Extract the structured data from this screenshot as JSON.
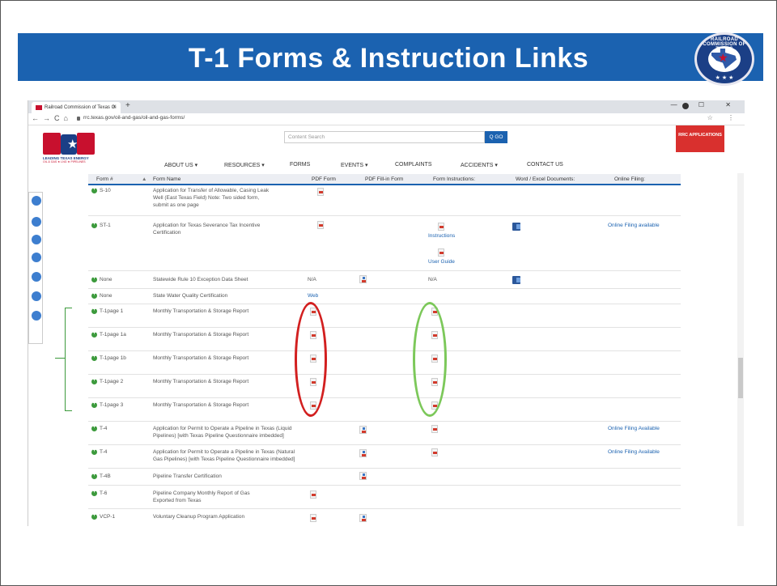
{
  "slide": {
    "title": "T-1 Forms & Instruction Links"
  },
  "seal": {
    "ring_text": "RAILROAD COMMISSION OF TEXAS",
    "bottom": "★ ★ ★"
  },
  "browser": {
    "tab_title": "Railroad Commission of Texas Oi",
    "tab_close": "×",
    "new_tab": "+",
    "window_controls": "—  ☐  ✕",
    "nav_icons": "←→C⌂",
    "url": "rrc.texas.gov/oil-and-gas/oil-and-gas-forms/",
    "addr_right": "☆ ⋮"
  },
  "site": {
    "logo_tag": "LEADING TEXAS ENERGY",
    "logo_sub": "OIL & GAS ★ LNG ★ PIPELINES",
    "search_placeholder": "Content Search",
    "search_button": "Q GO",
    "rrc_apps": "RRC APPLICATIONS",
    "nav": [
      "ABOUT US ▾",
      "RESOURCES ▾",
      "FORMS",
      "EVENTS ▾",
      "COMPLAINTS",
      "ACCIDENTS ▾",
      "CONTACT US"
    ]
  },
  "table": {
    "headers": [
      "Form #",
      "Form Name",
      "PDF Form",
      "PDF Fill-in Form",
      "Form Instructions:",
      "Word / Excel Documents:",
      "Online Filing:"
    ],
    "rows": [
      {
        "form": "S-10",
        "name": "Application for Transfer of Allowable, Casing Leak Well (East Texas Field) Note: Two sided form, submit as one page",
        "pdf": true
      },
      {
        "form": "ST-1",
        "name": "Application for Texas Severance Tax Incentive Certification",
        "pdf": true,
        "instr": "Instructions",
        "instr2": "User Guide",
        "word": true,
        "online": "Online Filing available"
      },
      {
        "form": "None",
        "name": "Statewide Rule 10 Exception Data Sheet",
        "pdf_text": "N/A",
        "fill": true,
        "instr_text": "N/A",
        "word": true
      },
      {
        "form": "None",
        "name": "State Water Quality Certification",
        "pdf_link": "Web"
      },
      {
        "form": "T-1page 1",
        "name": "Monthly Transportation & Storage Report",
        "pdf": true,
        "instr_icon": true
      },
      {
        "form": "T-1page 1a",
        "name": "Monthly Transportation & Storage Report",
        "pdf": true,
        "instr_icon": true
      },
      {
        "form": "T-1page 1b",
        "name": "Monthly Transportation & Storage Report",
        "pdf": true,
        "instr_icon": true
      },
      {
        "form": "T-1page 2",
        "name": "Monthly Transportation & Storage Report",
        "pdf": true,
        "instr_icon": true
      },
      {
        "form": "T-1page 3",
        "name": "Monthly Transportation & Storage Report",
        "pdf": true,
        "instr_icon": true
      },
      {
        "form": "T-4",
        "name": "Application for Permit to Operate a Pipeline in Texas (Liquid Pipelines) [with Texas Pipeline Questionnaire imbedded]",
        "fill": true,
        "instr_icon": true,
        "online": "Online Filing Available"
      },
      {
        "form": "T-4",
        "name": "Application for Permit to Operate a Pipeline in Texas (Natural Gas Pipelines) [with Texas Pipeline Questionnaire imbedded]",
        "fill": true,
        "instr_icon": true,
        "online": "Online Filing Available"
      },
      {
        "form": "T-4B",
        "name": "Pipeline Transfer Certification",
        "fill": true
      },
      {
        "form": "T-6",
        "name": "Pipeline Company Monthly Report of Gas Exported from Texas",
        "pdf": true
      },
      {
        "form": "VCP-1",
        "name": "Voluntary Cleanup Program Application",
        "pdf": true,
        "fill": true
      }
    ]
  },
  "colors": {
    "title_bar": "#1b62b0",
    "annotation_red": "#d21f1f",
    "annotation_green": "#7cc85a"
  }
}
